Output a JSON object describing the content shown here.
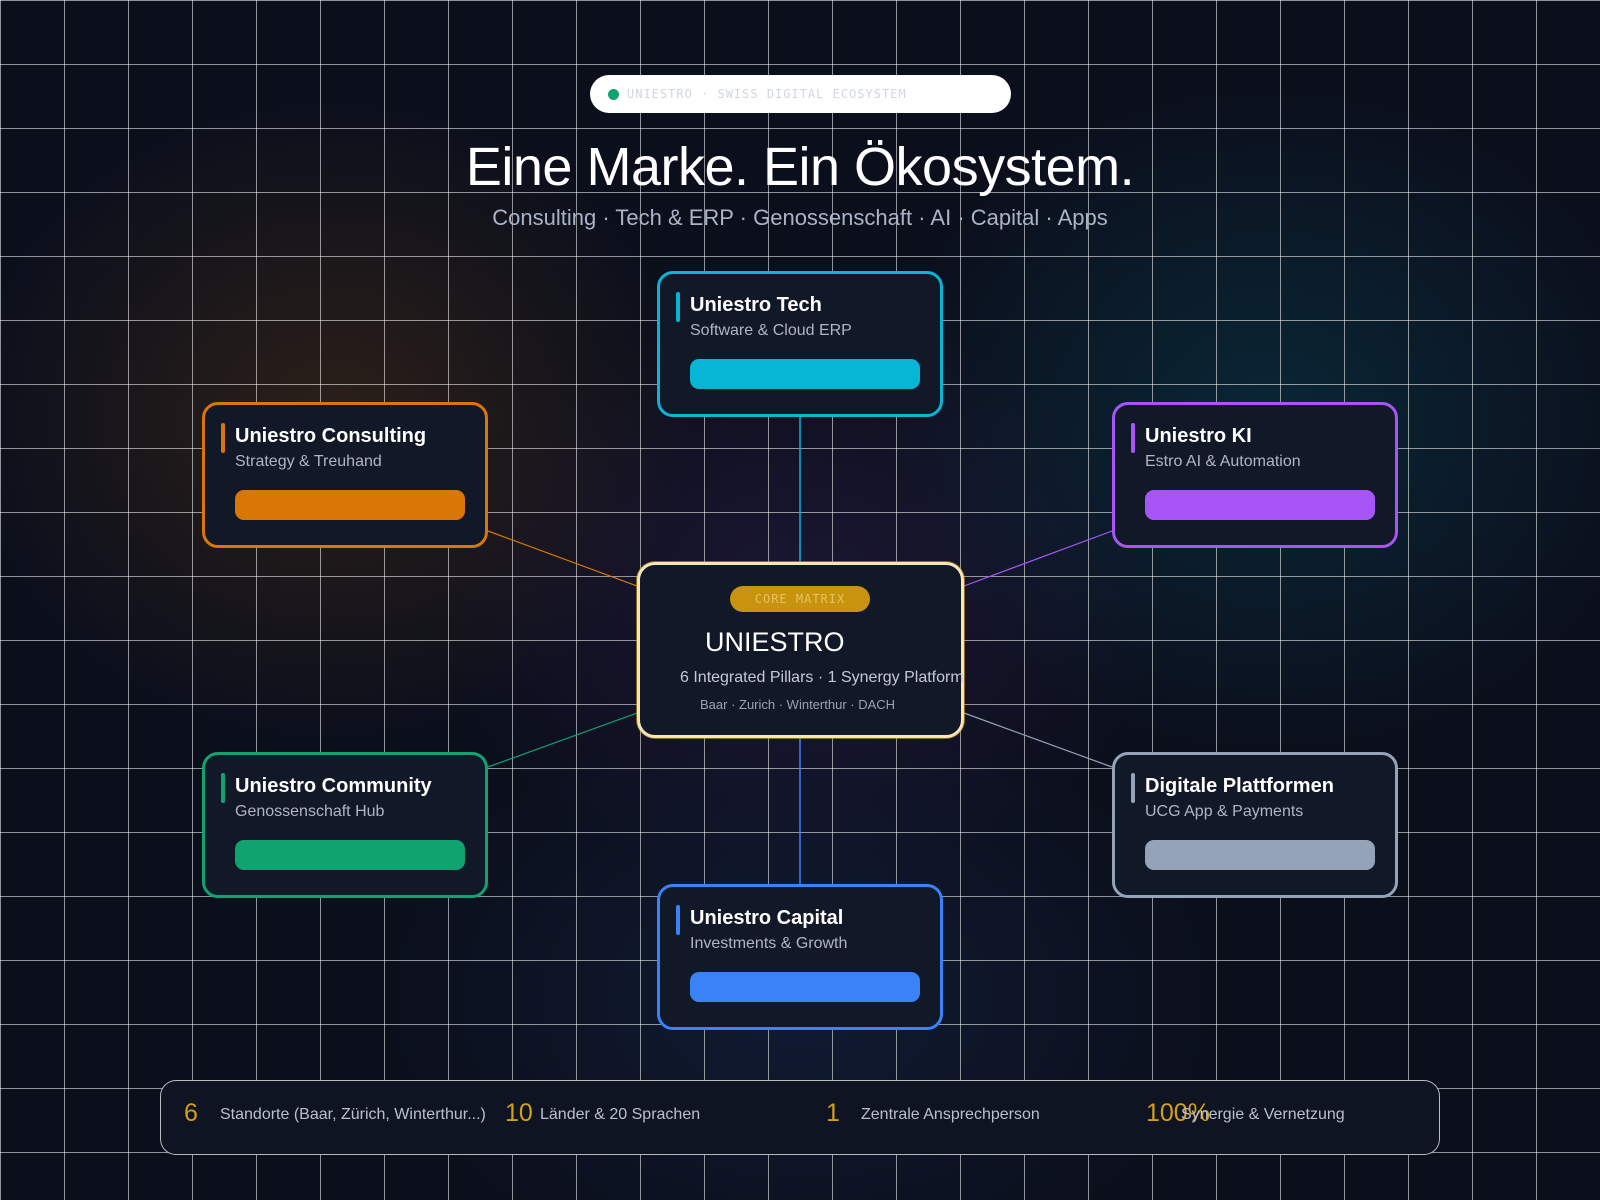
{
  "header": {
    "pill_text": "UNIESTRO · SWISS DIGITAL ECOSYSTEM",
    "title": "Eine Marke. Ein Ökosystem.",
    "subtitle": "Consulting · Tech & ERP · Genossenschaft · AI · Capital · Apps"
  },
  "core": {
    "badge": "CORE MATRIX",
    "title": "UNIESTRO",
    "subtitle": "6 Integrated Pillars · 1 Synergy Platform",
    "locations": "Baar · Zurich · Winterthur · DACH",
    "border_color": "#d4a017"
  },
  "pillars": [
    {
      "id": "tech",
      "title": "Uniestro Tech",
      "subtitle": "Software & Cloud ERP",
      "color": "#06b6d4"
    },
    {
      "id": "consulting",
      "title": "Uniestro Consulting",
      "subtitle": "Strategy & Treuhand",
      "color": "#d97706"
    },
    {
      "id": "ki",
      "title": "Uniestro KI",
      "subtitle": "Estro AI & Automation",
      "color": "#a855f7"
    },
    {
      "id": "community",
      "title": "Uniestro Community",
      "subtitle": "Genossenschaft Hub",
      "color": "#10a36f"
    },
    {
      "id": "platforms",
      "title": "Digitale Plattformen",
      "subtitle": "UCG App & Payments",
      "color": "#94a3b8"
    },
    {
      "id": "capital",
      "title": "Uniestro Capital",
      "subtitle": "Investments & Growth",
      "color": "#3b82f6"
    }
  ],
  "stats": [
    {
      "number": "6",
      "label": "Standorte (Baar, Zürich, Winterthur...)"
    },
    {
      "number": "10",
      "label": "Länder & 20 Sprachen"
    },
    {
      "number": "1",
      "label": "Zentrale Ansprechperson"
    },
    {
      "number": "100%",
      "label": "Synergie & Vernetzung"
    }
  ],
  "colors": {
    "background": "#0b0f1c",
    "card_background": "#111828",
    "stat_accent": "#d4a017"
  }
}
